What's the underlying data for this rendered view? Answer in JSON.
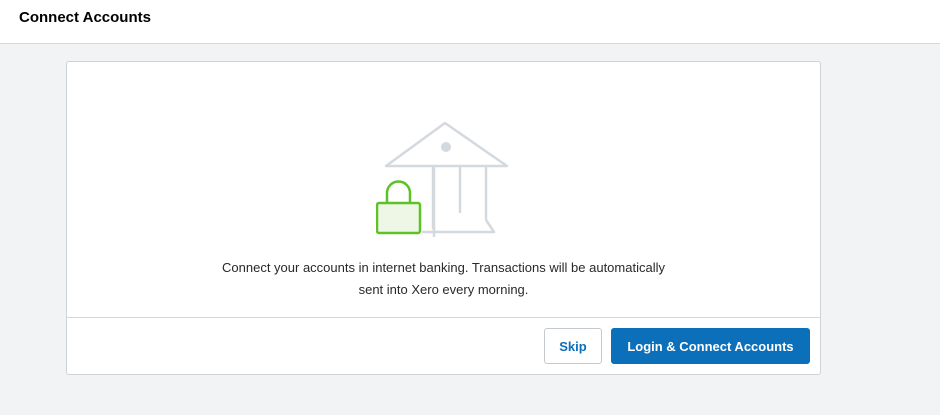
{
  "header": {
    "title": "Connect Accounts"
  },
  "card": {
    "message_line1": "Connect your accounts in internet banking. Transactions will be automatically",
    "message_line2": "sent into Xero every morning.",
    "illustration": {
      "icons": [
        "bank-icon",
        "padlock-icon"
      ],
      "bank_color": "#d3d9de",
      "padlock_color": "#5cc227",
      "padlock_fill": "#eef6e5"
    },
    "actions": {
      "skip_label": "Skip",
      "primary_label": "Login & Connect Accounts"
    }
  },
  "colors": {
    "accent": "#0b6fba",
    "background": "#f2f3f4"
  }
}
